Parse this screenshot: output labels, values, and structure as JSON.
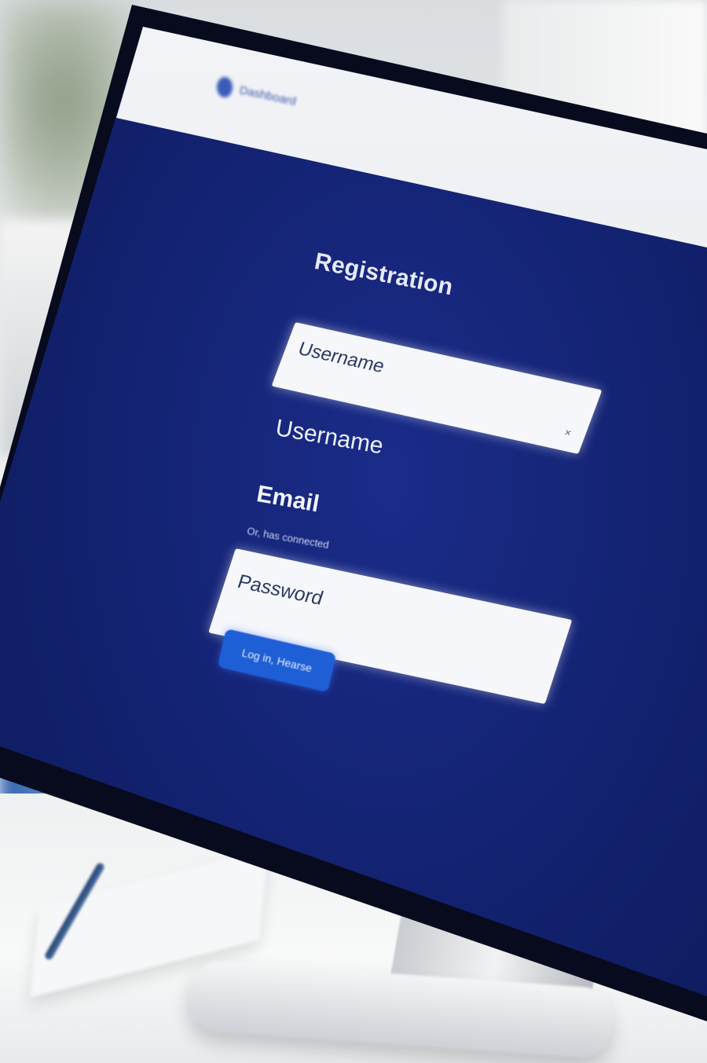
{
  "browser": {
    "header_title": "Dashboard"
  },
  "form": {
    "title": "Registration",
    "username_placeholder": "Username",
    "username_label": "Username",
    "email_label": "Email",
    "helper_text": "Or, has connected",
    "password_placeholder": "Password",
    "submit_label": "Log in, Hearse"
  },
  "colors": {
    "screen_background": "#142373",
    "button": "#1e5fd6",
    "input_background": "#f6f7fb"
  }
}
